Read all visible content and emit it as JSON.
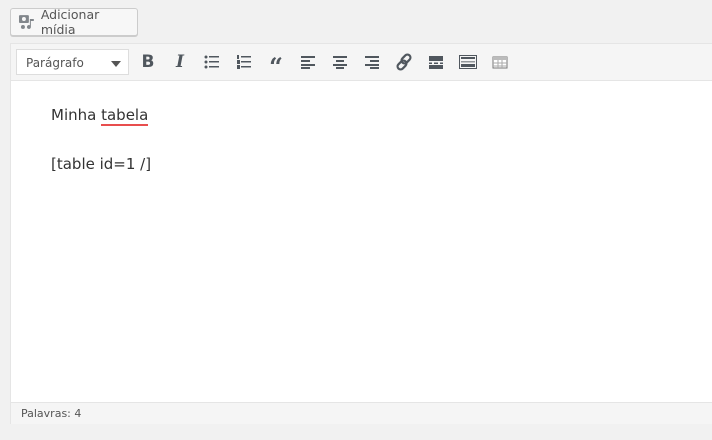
{
  "media_button": {
    "label": "Adicionar mídia"
  },
  "toolbar": {
    "format_select": "Parágrafo",
    "buttons": [
      "bold",
      "italic",
      "bulleted-list",
      "numbered-list",
      "blockquote",
      "align-left",
      "align-center",
      "align-right",
      "link",
      "read-more",
      "toolbar-toggle",
      "table"
    ]
  },
  "content": {
    "line1_prefix": "Minha ",
    "line1_misspelled": "tabela",
    "line2": "[table id=1 /]"
  },
  "status": {
    "word_count": "Palavras: 4"
  }
}
